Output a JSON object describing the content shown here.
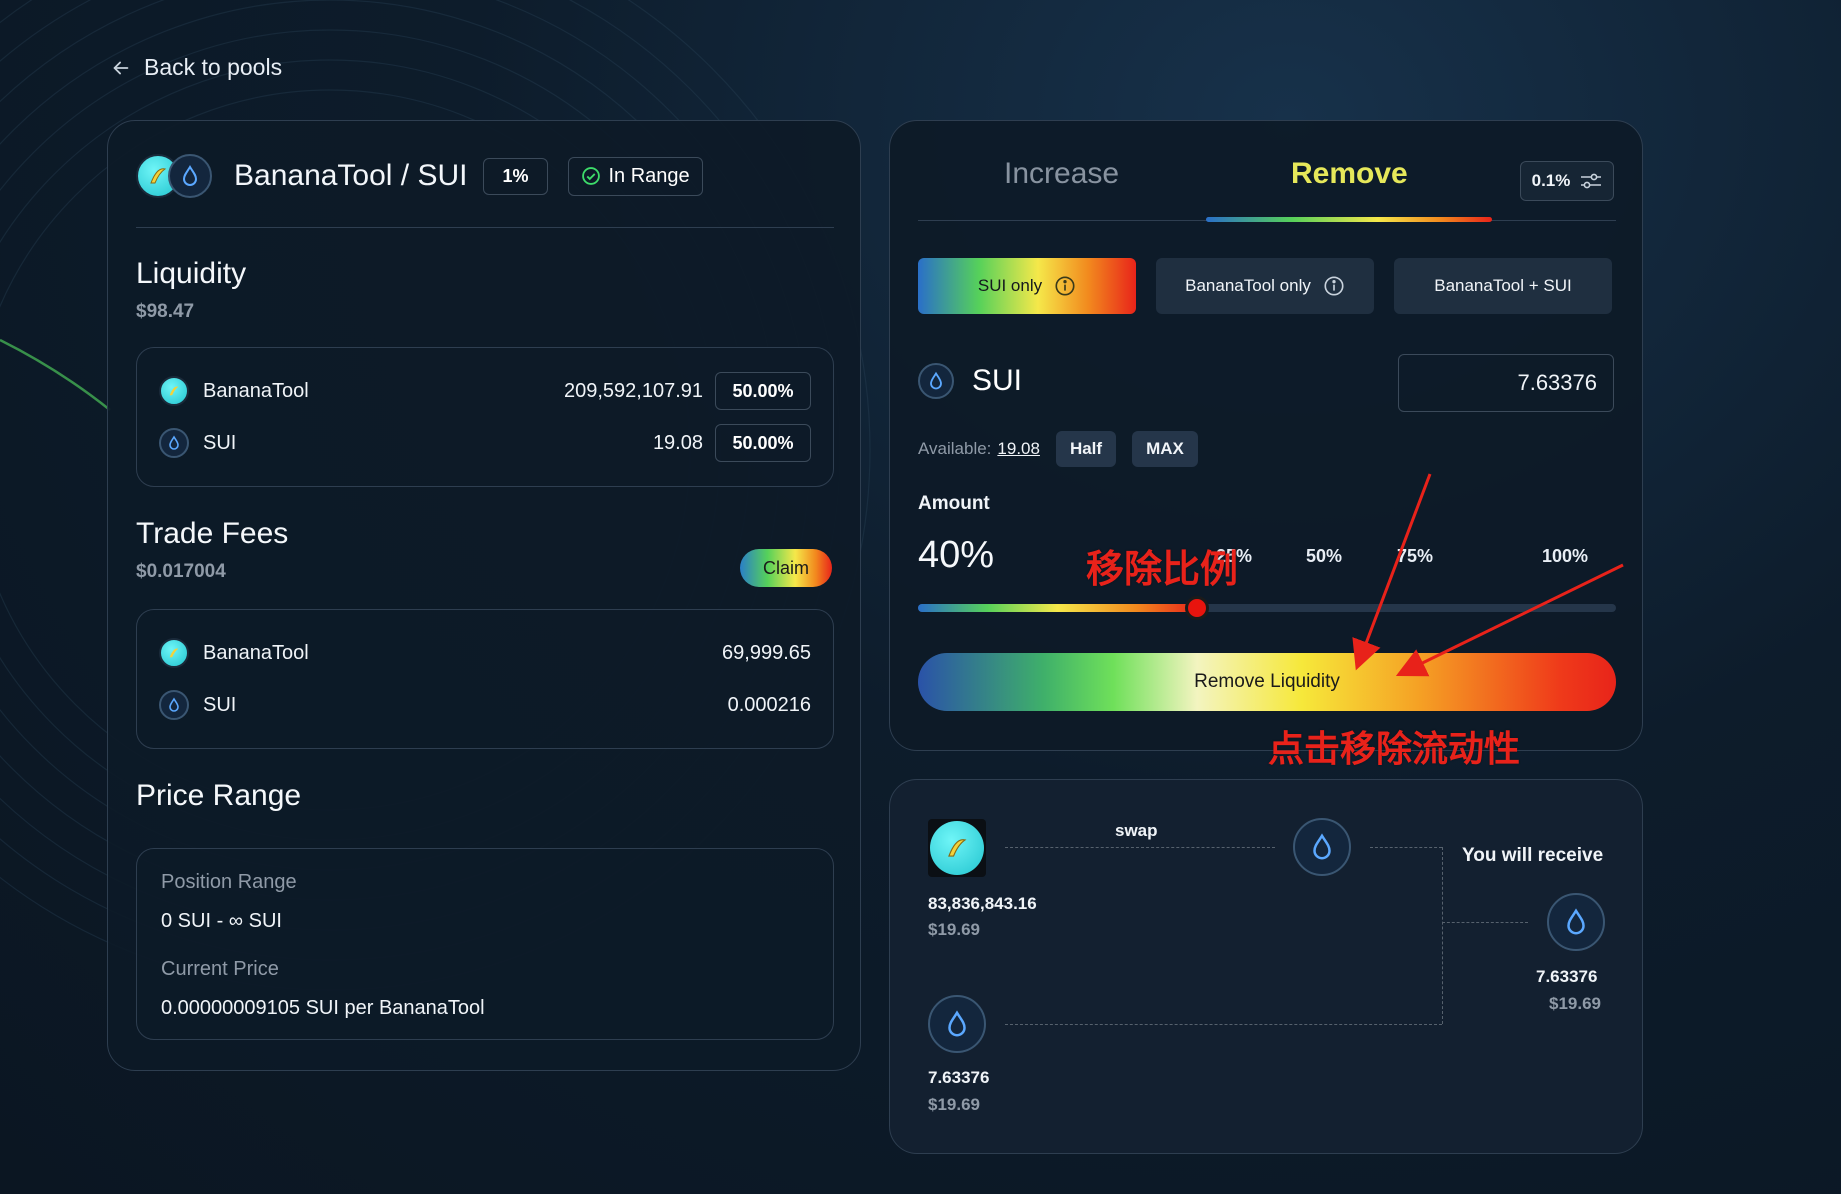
{
  "nav": {
    "back_label": "Back to pools"
  },
  "pair": {
    "title": "BananaTool / SUI",
    "fee_tier": "1%",
    "range_status": "In Range"
  },
  "liquidity": {
    "title": "Liquidity",
    "value": "$98.47",
    "rows": [
      {
        "token": "BananaTool",
        "amount": "209,592,107.91",
        "pct": "50.00%"
      },
      {
        "token": "SUI",
        "amount": "19.08",
        "pct": "50.00%"
      }
    ]
  },
  "trade_fees": {
    "title": "Trade Fees",
    "value": "$0.017004",
    "claim_label": "Claim",
    "rows": [
      {
        "token": "BananaTool",
        "amount": "69,999.65"
      },
      {
        "token": "SUI",
        "amount": "0.000216"
      }
    ]
  },
  "price_range": {
    "title": "Price Range",
    "position_label": "Position Range",
    "position_value": "0 SUI - ∞ SUI",
    "current_label": "Current Price",
    "current_value": "0.00000009105 SUI per BananaTool"
  },
  "remove_panel": {
    "tabs": {
      "increase": "Increase",
      "remove": "Remove"
    },
    "slippage": "0.1%",
    "modes": {
      "sui_only": "SUI only",
      "banana_only": "BananaTool only",
      "both": "BananaTool + SUI"
    },
    "selected_token": "SUI",
    "input_value": "7.63376",
    "available_label": "Available:",
    "available_value": "19.08",
    "half_label": "Half",
    "max_label": "MAX",
    "amount_label": "Amount",
    "amount_pct": "40%",
    "amount_fraction": 0.4,
    "presets": [
      "25%",
      "50%",
      "75%",
      "100%"
    ],
    "remove_button": "Remove Liquidity"
  },
  "receive": {
    "swap_label": "swap",
    "you_receive_label": "You will receive",
    "banana_amount": "83,836,843.16",
    "banana_usd": "$19.69",
    "sui_amount": "7.63376",
    "sui_usd": "$19.69",
    "receive_amount": "7.63376",
    "receive_usd": "$19.69"
  },
  "annotations": {
    "ratio": "移除比例",
    "click_remove": "点击移除流动性"
  },
  "colors": {
    "accent_yellow": "#e6e85a",
    "annotation_red": "#e8221a",
    "in_range_green": "#3ddc6a"
  },
  "icons": {
    "back": "arrow-left-icon",
    "in_range": "check-circle-icon",
    "sui": "sui-droplet-icon",
    "banana": "bananatool-logo",
    "info": "info-icon",
    "settings": "sliders-icon"
  }
}
